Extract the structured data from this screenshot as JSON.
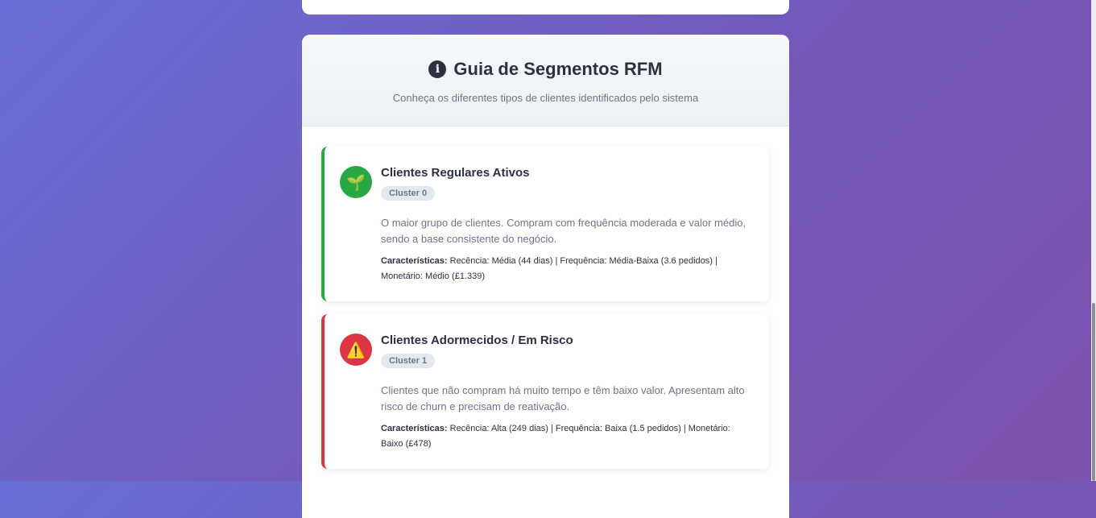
{
  "guide": {
    "title": "Guia de Segmentos RFM",
    "subtitle": "Conheça os diferentes tipos de clientes identificados pelo sistema",
    "icon": "info-icon"
  },
  "segments": [
    {
      "icon": "seedling-icon",
      "icon_glyph": "🌱",
      "color": "#28a745",
      "title": "Clientes Regulares Ativos",
      "badge": "Cluster 0",
      "description": "O maior grupo de clientes. Compram com frequência moderada e valor médio, sendo a base consistente do negócio.",
      "characteristics_label": "Características:",
      "characteristics": "Recência: Média (44 dias) | Frequência: Média-Baixa (3.6 pedidos) | Monetário: Médio (£1.339)"
    },
    {
      "icon": "warning-icon",
      "icon_glyph": "⚠️",
      "color": "#dc3545",
      "title": "Clientes Adormecidos / Em Risco",
      "badge": "Cluster 1",
      "description": "Clientes que não compram há muito tempo e têm baixo valor. Apresentam alto risco de churn e precisam de reativação.",
      "characteristics_label": "Características:",
      "characteristics": "Recência: Alta (249 dias) | Frequência: Baixa (1.5 pedidos) | Monetário: Baixo (£478)"
    }
  ]
}
